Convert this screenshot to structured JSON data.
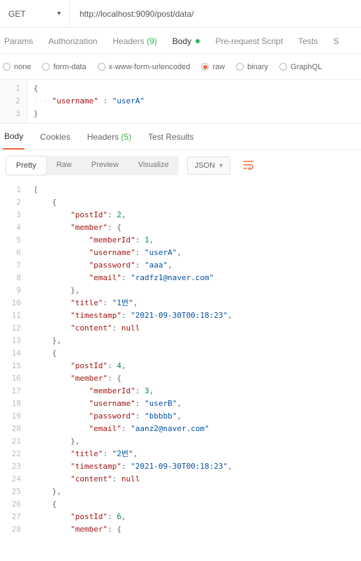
{
  "request": {
    "method": "GET",
    "url": "http://localhost:9090/post/data/"
  },
  "tabs": {
    "params": "Params",
    "authorization": "Authorization",
    "headers": "Headers",
    "headers_count": "(9)",
    "body": "Body",
    "prerequest": "Pre-request Script",
    "tests": "Tests",
    "settings": "S"
  },
  "body_types": {
    "none": "none",
    "formdata": "form-data",
    "urlencoded": "x-www-form-urlencoded",
    "raw": "raw",
    "binary": "binary",
    "graphql": "GraphQL"
  },
  "request_body": {
    "line1": "{",
    "line2_key": "\"username\"",
    "line2_val": "\"userA\"",
    "line3": "}"
  },
  "response_tabs": {
    "body": "Body",
    "cookies": "Cookies",
    "headers": "Headers",
    "headers_count": "(5)",
    "testresults": "Test Results"
  },
  "view_modes": {
    "pretty": "Pretty",
    "raw": "Raw",
    "preview": "Preview",
    "visualize": "Visualize",
    "format": "JSON"
  },
  "chart_data": {
    "type": "table",
    "title": "Response JSON",
    "data": [
      {
        "postId": 2,
        "member": {
          "memberId": 1,
          "username": "userA",
          "password": "aaa",
          "email": "radfz1@naver.com"
        },
        "title": "1번",
        "timestamp": "2021-09-30T00:18:23",
        "content": null
      },
      {
        "postId": 4,
        "member": {
          "memberId": 3,
          "username": "userB",
          "password": "bbbbb",
          "email": "aanz2@naver.com"
        },
        "title": "2번",
        "timestamp": "2021-09-30T00:18:23",
        "content": null
      },
      {
        "postId": 6,
        "member": {}
      }
    ]
  },
  "resp_lines": [
    {
      "n": 1,
      "ind": 0,
      "parts": [
        {
          "t": "[",
          "c": "punc"
        }
      ]
    },
    {
      "n": 2,
      "ind": 1,
      "parts": [
        {
          "t": "{",
          "c": "punc"
        }
      ]
    },
    {
      "n": 3,
      "ind": 2,
      "parts": [
        {
          "t": "\"postId\"",
          "c": "key"
        },
        {
          "t": ": ",
          "c": "punc"
        },
        {
          "t": "2",
          "c": "num"
        },
        {
          "t": ",",
          "c": "punc"
        }
      ]
    },
    {
      "n": 4,
      "ind": 2,
      "parts": [
        {
          "t": "\"member\"",
          "c": "key"
        },
        {
          "t": ": {",
          "c": "punc"
        }
      ]
    },
    {
      "n": 5,
      "ind": 3,
      "parts": [
        {
          "t": "\"memberId\"",
          "c": "key"
        },
        {
          "t": ": ",
          "c": "punc"
        },
        {
          "t": "1",
          "c": "num"
        },
        {
          "t": ",",
          "c": "punc"
        }
      ]
    },
    {
      "n": 6,
      "ind": 3,
      "parts": [
        {
          "t": "\"username\"",
          "c": "key"
        },
        {
          "t": ": ",
          "c": "punc"
        },
        {
          "t": "\"userA\"",
          "c": "str"
        },
        {
          "t": ",",
          "c": "punc"
        }
      ]
    },
    {
      "n": 7,
      "ind": 3,
      "parts": [
        {
          "t": "\"password\"",
          "c": "key"
        },
        {
          "t": ": ",
          "c": "punc"
        },
        {
          "t": "\"aaa\"",
          "c": "str"
        },
        {
          "t": ",",
          "c": "punc"
        }
      ]
    },
    {
      "n": 8,
      "ind": 3,
      "parts": [
        {
          "t": "\"email\"",
          "c": "key"
        },
        {
          "t": ": ",
          "c": "punc"
        },
        {
          "t": "\"radfz1@naver.com\"",
          "c": "str"
        }
      ]
    },
    {
      "n": 9,
      "ind": 2,
      "parts": [
        {
          "t": "},",
          "c": "punc"
        }
      ]
    },
    {
      "n": 10,
      "ind": 2,
      "parts": [
        {
          "t": "\"title\"",
          "c": "key"
        },
        {
          "t": ": ",
          "c": "punc"
        },
        {
          "t": "\"1번\"",
          "c": "str"
        },
        {
          "t": ",",
          "c": "punc"
        }
      ]
    },
    {
      "n": 11,
      "ind": 2,
      "parts": [
        {
          "t": "\"timestamp\"",
          "c": "key"
        },
        {
          "t": ": ",
          "c": "punc"
        },
        {
          "t": "\"2021-09-30T00:18:23\"",
          "c": "str"
        },
        {
          "t": ",",
          "c": "punc"
        }
      ]
    },
    {
      "n": 12,
      "ind": 2,
      "parts": [
        {
          "t": "\"content\"",
          "c": "key"
        },
        {
          "t": ": ",
          "c": "punc"
        },
        {
          "t": "null",
          "c": "null"
        }
      ]
    },
    {
      "n": 13,
      "ind": 1,
      "parts": [
        {
          "t": "},",
          "c": "punc"
        }
      ]
    },
    {
      "n": 14,
      "ind": 1,
      "parts": [
        {
          "t": "{",
          "c": "punc"
        }
      ]
    },
    {
      "n": 15,
      "ind": 2,
      "parts": [
        {
          "t": "\"postId\"",
          "c": "key"
        },
        {
          "t": ": ",
          "c": "punc"
        },
        {
          "t": "4",
          "c": "num"
        },
        {
          "t": ",",
          "c": "punc"
        }
      ]
    },
    {
      "n": 16,
      "ind": 2,
      "parts": [
        {
          "t": "\"member\"",
          "c": "key"
        },
        {
          "t": ": {",
          "c": "punc"
        }
      ]
    },
    {
      "n": 17,
      "ind": 3,
      "parts": [
        {
          "t": "\"memberId\"",
          "c": "key"
        },
        {
          "t": ": ",
          "c": "punc"
        },
        {
          "t": "3",
          "c": "num"
        },
        {
          "t": ",",
          "c": "punc"
        }
      ]
    },
    {
      "n": 18,
      "ind": 3,
      "parts": [
        {
          "t": "\"username\"",
          "c": "key"
        },
        {
          "t": ": ",
          "c": "punc"
        },
        {
          "t": "\"userB\"",
          "c": "str"
        },
        {
          "t": ",",
          "c": "punc"
        }
      ]
    },
    {
      "n": 19,
      "ind": 3,
      "parts": [
        {
          "t": "\"password\"",
          "c": "key"
        },
        {
          "t": ": ",
          "c": "punc"
        },
        {
          "t": "\"bbbbb\"",
          "c": "str"
        },
        {
          "t": ",",
          "c": "punc"
        }
      ]
    },
    {
      "n": 20,
      "ind": 3,
      "parts": [
        {
          "t": "\"email\"",
          "c": "key"
        },
        {
          "t": ": ",
          "c": "punc"
        },
        {
          "t": "\"aanz2@naver.com\"",
          "c": "str"
        }
      ]
    },
    {
      "n": 21,
      "ind": 2,
      "parts": [
        {
          "t": "},",
          "c": "punc"
        }
      ]
    },
    {
      "n": 22,
      "ind": 2,
      "parts": [
        {
          "t": "\"title\"",
          "c": "key"
        },
        {
          "t": ": ",
          "c": "punc"
        },
        {
          "t": "\"2번\"",
          "c": "str"
        },
        {
          "t": ",",
          "c": "punc"
        }
      ]
    },
    {
      "n": 23,
      "ind": 2,
      "parts": [
        {
          "t": "\"timestamp\"",
          "c": "key"
        },
        {
          "t": ": ",
          "c": "punc"
        },
        {
          "t": "\"2021-09-30T00:18:23\"",
          "c": "str"
        },
        {
          "t": ",",
          "c": "punc"
        }
      ]
    },
    {
      "n": 24,
      "ind": 2,
      "parts": [
        {
          "t": "\"content\"",
          "c": "key"
        },
        {
          "t": ": ",
          "c": "punc"
        },
        {
          "t": "null",
          "c": "null"
        }
      ]
    },
    {
      "n": 25,
      "ind": 1,
      "parts": [
        {
          "t": "},",
          "c": "punc"
        }
      ]
    },
    {
      "n": 26,
      "ind": 1,
      "parts": [
        {
          "t": "{",
          "c": "punc"
        }
      ]
    },
    {
      "n": 27,
      "ind": 2,
      "parts": [
        {
          "t": "\"postId\"",
          "c": "key"
        },
        {
          "t": ": ",
          "c": "punc"
        },
        {
          "t": "6",
          "c": "num"
        },
        {
          "t": ",",
          "c": "punc"
        }
      ]
    },
    {
      "n": 28,
      "ind": 2,
      "parts": [
        {
          "t": "\"member\"",
          "c": "key"
        },
        {
          "t": ": {",
          "c": "punc"
        }
      ]
    }
  ]
}
